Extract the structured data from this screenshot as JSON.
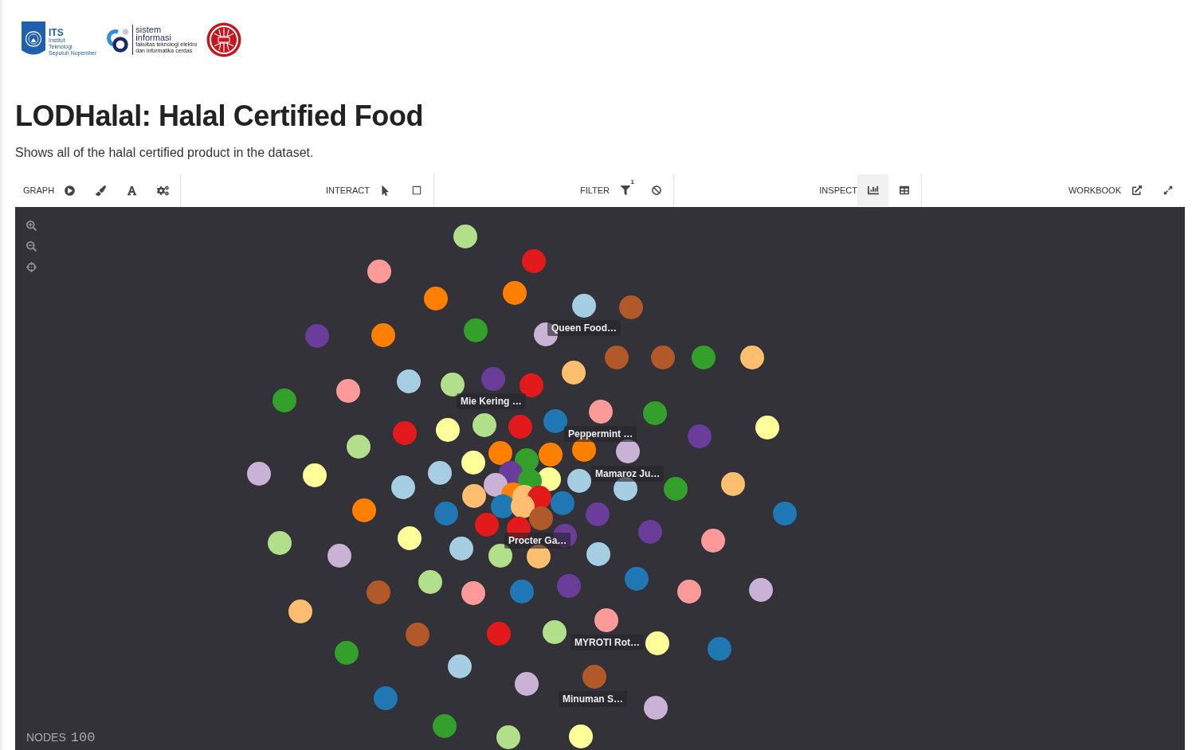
{
  "logos": [
    {
      "kind": "shield",
      "heading": [
        "ITS"
      ],
      "lines": [
        "Institut",
        "Teknologi",
        "Sepuluh Nopember"
      ]
    },
    {
      "kind": "rings",
      "heading": [
        "sistem",
        "informasi"
      ],
      "lines": [
        "fakultas teknologi elektro",
        "dan informatika cerdas"
      ]
    },
    {
      "kind": "seal"
    }
  ],
  "title": "LODHalal: Halal Certified Food",
  "description": "Shows all of the halal certified product in the dataset.",
  "toolbar": {
    "sections": [
      {
        "label": "GRAPH",
        "buttons": [
          {
            "selected": false
          },
          {
            "selected": false
          },
          {
            "selected": false
          },
          {
            "selected": false
          }
        ]
      },
      {
        "label": "INTERACT",
        "buttons": [
          {
            "selected": false
          },
          {
            "selected": false
          }
        ]
      },
      {
        "label": "FILTER",
        "buttons": [
          {
            "selected": false,
            "badge": "1"
          },
          {
            "selected": false
          }
        ]
      },
      {
        "label": "INSPECT",
        "buttons": [
          {
            "selected": true
          },
          {
            "selected": false
          }
        ]
      },
      {
        "label": "WORKBOOK",
        "buttons": [
          {
            "selected": false
          },
          {
            "selected": false
          }
        ]
      }
    ]
  },
  "graph": {
    "nodes": [
      {
        "color": "#b2df8a"
      },
      {
        "color": "#e31a1c"
      },
      {
        "color": "#fb9a99"
      },
      {
        "color": "#ff7f00"
      },
      {
        "color": "#ff7f00"
      },
      {
        "color": "#a6cee3"
      },
      {
        "color": "#b15928"
      },
      {
        "color": "#6a3d9a"
      },
      {
        "color": "#ff7f00"
      },
      {
        "color": "#33a02c"
      },
      {
        "color": "#cab2d6"
      },
      {
        "color": "#b15928"
      },
      {
        "color": "#b15928"
      },
      {
        "color": "#33a02c"
      },
      {
        "color": "#fdbf6f"
      },
      {
        "color": "#a6cee3"
      },
      {
        "color": "#b2df8a"
      },
      {
        "color": "#6a3d9a"
      },
      {
        "color": "#e31a1c"
      },
      {
        "color": "#fdbf6f"
      },
      {
        "color": "#33a02c"
      },
      {
        "color": "#fb9a99"
      },
      {
        "color": "#fb9a99"
      },
      {
        "color": "#33a02c"
      },
      {
        "color": "#6a3d9a"
      },
      {
        "color": "#ffff99"
      },
      {
        "color": "#e31a1c"
      },
      {
        "color": "#ffff99"
      },
      {
        "color": "#b2df8a"
      },
      {
        "color": "#e31a1c"
      },
      {
        "color": "#1f78b4"
      },
      {
        "color": "#ff7f00"
      },
      {
        "color": "#cab2d6"
      },
      {
        "color": "#b2df8a"
      },
      {
        "color": "#cab2d6"
      },
      {
        "color": "#ffff99"
      },
      {
        "color": "#ffff99"
      },
      {
        "color": "#ff7f00"
      },
      {
        "color": "#33a02c"
      },
      {
        "color": "#ff7f00"
      },
      {
        "color": "#a6cee3"
      },
      {
        "color": "#6a3d9a"
      },
      {
        "color": "#ffff99"
      },
      {
        "color": "#33a02c"
      },
      {
        "color": "#cab2d6"
      },
      {
        "color": "#a6cee3"
      },
      {
        "color": "#a6cee3"
      },
      {
        "color": "#33a02c"
      },
      {
        "color": "#fdbf6f"
      },
      {
        "color": "#a6cee3"
      },
      {
        "color": "#fdbf6f"
      },
      {
        "color": "#ff7f00"
      },
      {
        "color": "#fdbf6f"
      },
      {
        "color": "#e31a1c"
      },
      {
        "color": "#1f78b4"
      },
      {
        "color": "#1f78b4"
      },
      {
        "color": "#fdbf6f"
      },
      {
        "color": "#1f78b4"
      },
      {
        "color": "#ff7f00"
      },
      {
        "color": "#1f78b4"
      },
      {
        "color": "#e31a1c"
      },
      {
        "color": "#e31a1c"
      },
      {
        "color": "#b15928"
      },
      {
        "color": "#6a3d9a"
      },
      {
        "color": "#6a3d9a"
      },
      {
        "color": "#6a3d9a"
      },
      {
        "color": "#fb9a99"
      },
      {
        "color": "#b2df8a"
      },
      {
        "color": "#ffff99"
      },
      {
        "color": "#cab2d6"
      },
      {
        "color": "#a6cee3"
      },
      {
        "color": "#b2df8a"
      },
      {
        "color": "#fdbf6f"
      },
      {
        "color": "#a6cee3"
      },
      {
        "color": "#b2df8a"
      },
      {
        "color": "#b15928"
      },
      {
        "color": "#fb9a99"
      },
      {
        "color": "#1f78b4"
      },
      {
        "color": "#6a3d9a"
      },
      {
        "color": "#1f78b4"
      },
      {
        "color": "#fb9a99"
      },
      {
        "color": "#cab2d6"
      },
      {
        "color": "#fdbf6f"
      },
      {
        "color": "#fb9a99"
      },
      {
        "color": "#b15928"
      },
      {
        "color": "#e31a1c"
      },
      {
        "color": "#b2df8a"
      },
      {
        "color": "#ffff99"
      },
      {
        "color": "#1f78b4"
      },
      {
        "color": "#33a02c"
      },
      {
        "color": "#a6cee3"
      },
      {
        "color": "#cab2d6"
      },
      {
        "color": "#b15928"
      },
      {
        "color": "#cab2d6"
      },
      {
        "color": "#1f78b4"
      },
      {
        "color": "#33a02c"
      },
      {
        "color": "#b2df8a"
      },
      {
        "color": "#ffff99"
      }
    ],
    "labels": [
      "Queen Food…",
      "Mie Kering …",
      "Peppermint …",
      "Mamaroz Ju…",
      "Procter Ga…",
      "MYROTI Rot…",
      "Minuman S…"
    ],
    "node_count": {
      "label": "NODES",
      "value": "100"
    }
  }
}
